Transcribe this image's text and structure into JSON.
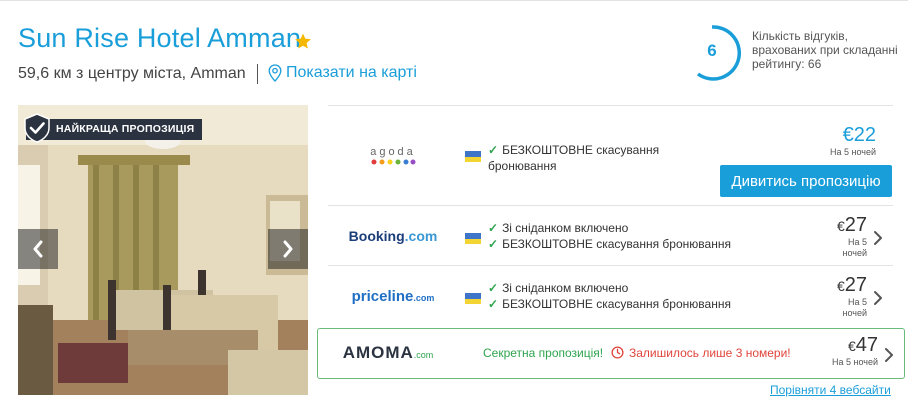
{
  "hotel": {
    "name": "Sun Rise Hotel Amman",
    "distance": "59,6 км з центру міста, Amman",
    "map_link": "Показати на карті"
  },
  "rating": {
    "value": "6",
    "reviews_text": "Кількість відгуків, врахованих при складанні рейтингу: 66"
  },
  "photo": {
    "badge": "НАЙКРАЩА ПРОПОЗИЦІЯ"
  },
  "offers": [
    {
      "provider": "agoda",
      "features": [
        "БЕЗКОШТОВНЕ скасування бронювання"
      ],
      "price": "€22",
      "nights": "На 5 ночей",
      "button": "Дивитись пропозицію"
    },
    {
      "provider": "Booking.com",
      "features": [
        "Зі сніданком включено",
        "БЕЗКОШТОВНЕ скасування бронювання"
      ],
      "price_currency": "€",
      "price_value": "27",
      "nights_1": "На 5",
      "nights_2": "ночей"
    },
    {
      "provider": "priceline.com",
      "features": [
        "Зі сніданком включено",
        "БЕЗКОШТОВНЕ скасування бронювання"
      ],
      "price_currency": "€",
      "price_value": "27",
      "nights_1": "На 5",
      "nights_2": "ночей"
    },
    {
      "provider": "AMOMA.com",
      "secret": "Секретна пропозиція!",
      "rooms_left": "Залишилось лише 3 номери!",
      "price_currency": "€",
      "price_value": "47",
      "nights": "На 5 ночей"
    }
  ],
  "compare_link": "Порівняти 4 вебсайти",
  "colors": {
    "accent": "#1a9ed9",
    "success": "#2da44e",
    "warning": "#e0443b",
    "star": "#f5b800"
  }
}
